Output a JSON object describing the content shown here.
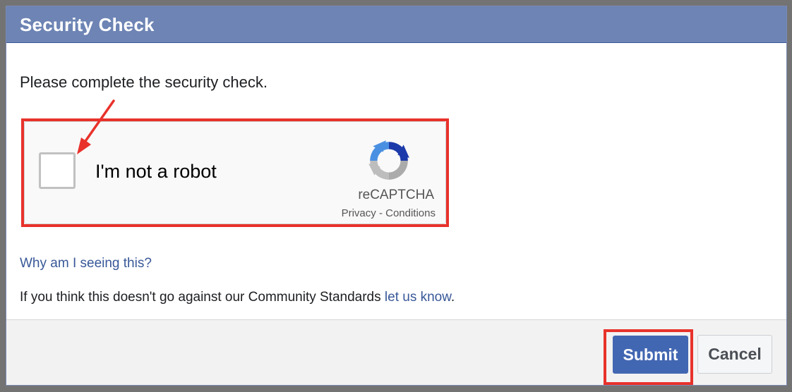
{
  "dialog": {
    "title": "Security Check",
    "prompt": "Please complete the security check."
  },
  "recaptcha": {
    "checkbox_label": "I'm not a robot",
    "brand": "reCAPTCHA",
    "privacy_link": "Privacy",
    "separator": "-",
    "conditions_link": "Conditions"
  },
  "help": {
    "why_link": "Why am I seeing this?",
    "standards_text": "If you think this doesn't go against our Community Standards",
    "standards_link": "let us know",
    "standards_end": "."
  },
  "footer": {
    "submit_label": "Submit",
    "cancel_label": "Cancel"
  },
  "colors": {
    "header": "#6d84b4",
    "link": "#385898",
    "primary_button": "#4267b2",
    "annotation": "#e8322b"
  },
  "icons": {
    "recaptcha_logo": "recaptcha-logo-icon",
    "annotation_arrow": "arrow-icon"
  }
}
